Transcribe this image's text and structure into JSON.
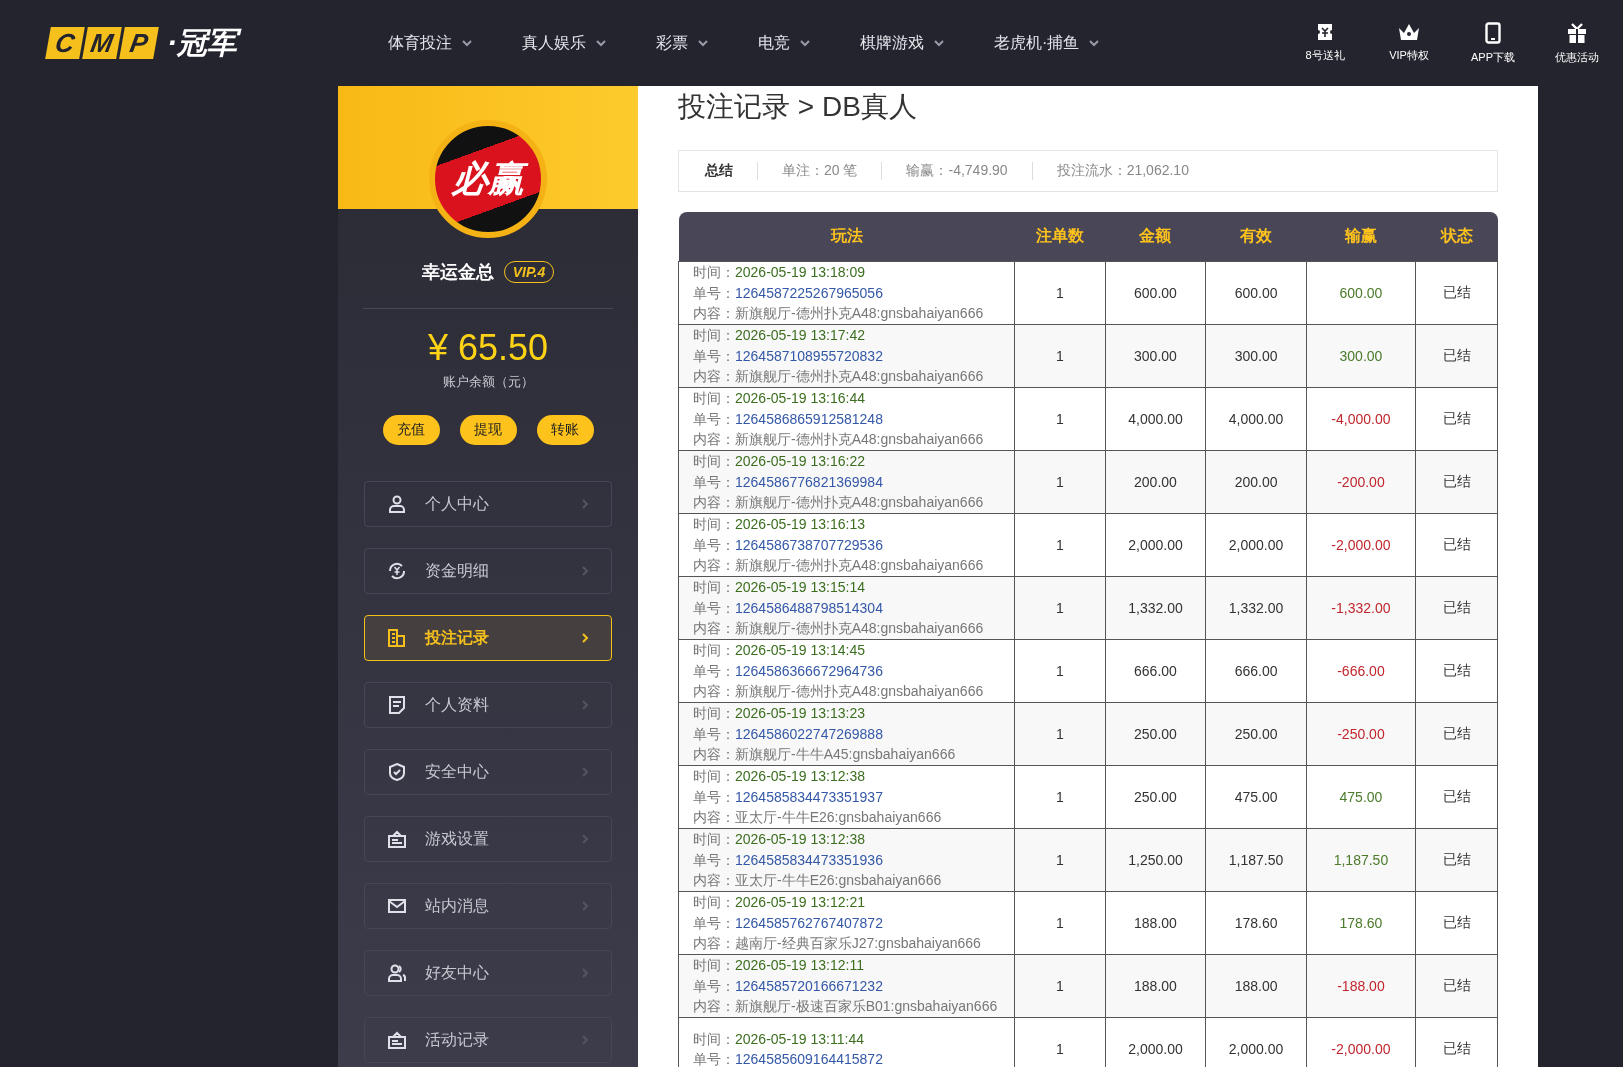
{
  "header": {
    "logo_letters": [
      "C",
      "M",
      "P"
    ],
    "logo_text": "·冠军",
    "nav": [
      {
        "label": "体育投注"
      },
      {
        "label": "真人娱乐"
      },
      {
        "label": "彩票"
      },
      {
        "label": "电竞"
      },
      {
        "label": "棋牌游戏"
      },
      {
        "label": "老虎机·捕鱼"
      }
    ],
    "actions": [
      {
        "kind": "ticket",
        "label": "8号送礼"
      },
      {
        "kind": "crown",
        "label": "VIP特权"
      },
      {
        "kind": "phone",
        "label": "APP下载"
      },
      {
        "kind": "gift",
        "label": "优惠活动"
      }
    ]
  },
  "profile": {
    "avatar_text": "必赢",
    "name": "幸运金总",
    "vip": "VIP.4",
    "balance": "¥ 65.50",
    "balance_label": "账户余额（元）",
    "buttons": [
      "充值",
      "提现",
      "转账"
    ]
  },
  "menu": [
    {
      "kind": "user",
      "label": "个人中心",
      "selected": false
    },
    {
      "kind": "yen",
      "label": "资金明细",
      "selected": false
    },
    {
      "kind": "record",
      "label": "投注记录",
      "selected": true
    },
    {
      "kind": "doc",
      "label": "个人资料",
      "selected": false
    },
    {
      "kind": "shield",
      "label": "安全中心",
      "selected": false
    },
    {
      "kind": "box",
      "label": "游戏设置",
      "selected": false
    },
    {
      "kind": "mail",
      "label": "站内消息",
      "selected": false
    },
    {
      "kind": "friends",
      "label": "好友中心",
      "selected": false
    },
    {
      "kind": "box",
      "label": "活动记录",
      "selected": false
    }
  ],
  "page_title": "投注记录 > DB真人",
  "summary": {
    "label": "总结",
    "items": [
      "单注：20 笔",
      "输赢：-4,749.90",
      "投注流水：21,062.10"
    ]
  },
  "table": {
    "columns": [
      "玩法",
      "注单数",
      "金额",
      "有效",
      "输赢",
      "状态"
    ],
    "rows": [
      {
        "time_label": "时间：",
        "time": "2026-05-19 13:18:09",
        "id_label": "单号：",
        "id": "1264587225267965056",
        "content_label": "内容：",
        "content": "新旗舰厅-德州扑克A48:gnsbahaiyan666",
        "count": "1",
        "amount": "600.00",
        "valid": "600.00",
        "result": "600.00",
        "color": "#4a7a2a",
        "status": "已结"
      },
      {
        "time_label": "时间：",
        "time": "2026-05-19 13:17:42",
        "id_label": "单号：",
        "id": "1264587108955720832",
        "content_label": "内容：",
        "content": "新旗舰厅-德州扑克A48:gnsbahaiyan666",
        "count": "1",
        "amount": "300.00",
        "valid": "300.00",
        "result": "300.00",
        "color": "#4a7a2a",
        "status": "已结"
      },
      {
        "time_label": "时间：",
        "time": "2026-05-19 13:16:44",
        "id_label": "单号：",
        "id": "1264586865912581248",
        "content_label": "内容：",
        "content": "新旗舰厅-德州扑克A48:gnsbahaiyan666",
        "count": "1",
        "amount": "4,000.00",
        "valid": "4,000.00",
        "result": "-4,000.00",
        "color": "#c0262d",
        "status": "已结"
      },
      {
        "time_label": "时间：",
        "time": "2026-05-19 13:16:22",
        "id_label": "单号：",
        "id": "1264586776821369984",
        "content_label": "内容：",
        "content": "新旗舰厅-德州扑克A48:gnsbahaiyan666",
        "count": "1",
        "amount": "200.00",
        "valid": "200.00",
        "result": "-200.00",
        "color": "#c0262d",
        "status": "已结"
      },
      {
        "time_label": "时间：",
        "time": "2026-05-19 13:16:13",
        "id_label": "单号：",
        "id": "1264586738707729536",
        "content_label": "内容：",
        "content": "新旗舰厅-德州扑克A48:gnsbahaiyan666",
        "count": "1",
        "amount": "2,000.00",
        "valid": "2,000.00",
        "result": "-2,000.00",
        "color": "#c0262d",
        "status": "已结"
      },
      {
        "time_label": "时间：",
        "time": "2026-05-19 13:15:14",
        "id_label": "单号：",
        "id": "1264586488798514304",
        "content_label": "内容：",
        "content": "新旗舰厅-德州扑克A48:gnsbahaiyan666",
        "count": "1",
        "amount": "1,332.00",
        "valid": "1,332.00",
        "result": "-1,332.00",
        "color": "#c0262d",
        "status": "已结"
      },
      {
        "time_label": "时间：",
        "time": "2026-05-19 13:14:45",
        "id_label": "单号：",
        "id": "1264586366672964736",
        "content_label": "内容：",
        "content": "新旗舰厅-德州扑克A48:gnsbahaiyan666",
        "count": "1",
        "amount": "666.00",
        "valid": "666.00",
        "result": "-666.00",
        "color": "#c0262d",
        "status": "已结"
      },
      {
        "time_label": "时间：",
        "time": "2026-05-19 13:13:23",
        "id_label": "单号：",
        "id": "1264586022747269888",
        "content_label": "内容：",
        "content": "新旗舰厅-牛牛A45:gnsbahaiyan666",
        "count": "1",
        "amount": "250.00",
        "valid": "250.00",
        "result": "-250.00",
        "color": "#c0262d",
        "status": "已结"
      },
      {
        "time_label": "时间：",
        "time": "2026-05-19 13:12:38",
        "id_label": "单号：",
        "id": "1264585834473351937",
        "content_label": "内容：",
        "content": "亚太厅-牛牛E26:gnsbahaiyan666",
        "count": "1",
        "amount": "250.00",
        "valid": "475.00",
        "result": "475.00",
        "color": "#4a7a2a",
        "status": "已结"
      },
      {
        "time_label": "时间：",
        "time": "2026-05-19 13:12:38",
        "id_label": "单号：",
        "id": "1264585834473351936",
        "content_label": "内容：",
        "content": "亚太厅-牛牛E26:gnsbahaiyan666",
        "count": "1",
        "amount": "1,250.00",
        "valid": "1,187.50",
        "result": "1,187.50",
        "color": "#4a7a2a",
        "status": "已结"
      },
      {
        "time_label": "时间：",
        "time": "2026-05-19 13:12:21",
        "id_label": "单号：",
        "id": "1264585762767407872",
        "content_label": "内容：",
        "content": "越南厅-经典百家乐J27:gnsbahaiyan666",
        "count": "1",
        "amount": "188.00",
        "valid": "178.60",
        "result": "178.60",
        "color": "#4a7a2a",
        "status": "已结"
      },
      {
        "time_label": "时间：",
        "time": "2026-05-19 13:12:11",
        "id_label": "单号：",
        "id": "1264585720166671232",
        "content_label": "内容：",
        "content": "新旗舰厅-极速百家乐B01:gnsbahaiyan666",
        "count": "1",
        "amount": "188.00",
        "valid": "188.00",
        "result": "-188.00",
        "color": "#c0262d",
        "status": "已结"
      },
      {
        "time_label": "时间：",
        "time": "2026-05-19 13:11:44",
        "id_label": "单号：",
        "id": "1264585609164415872",
        "count": "1",
        "amount": "2,000.00",
        "valid": "2,000.00",
        "result": "-2,000.00",
        "color": "#c0262d",
        "status": "已结"
      }
    ]
  }
}
